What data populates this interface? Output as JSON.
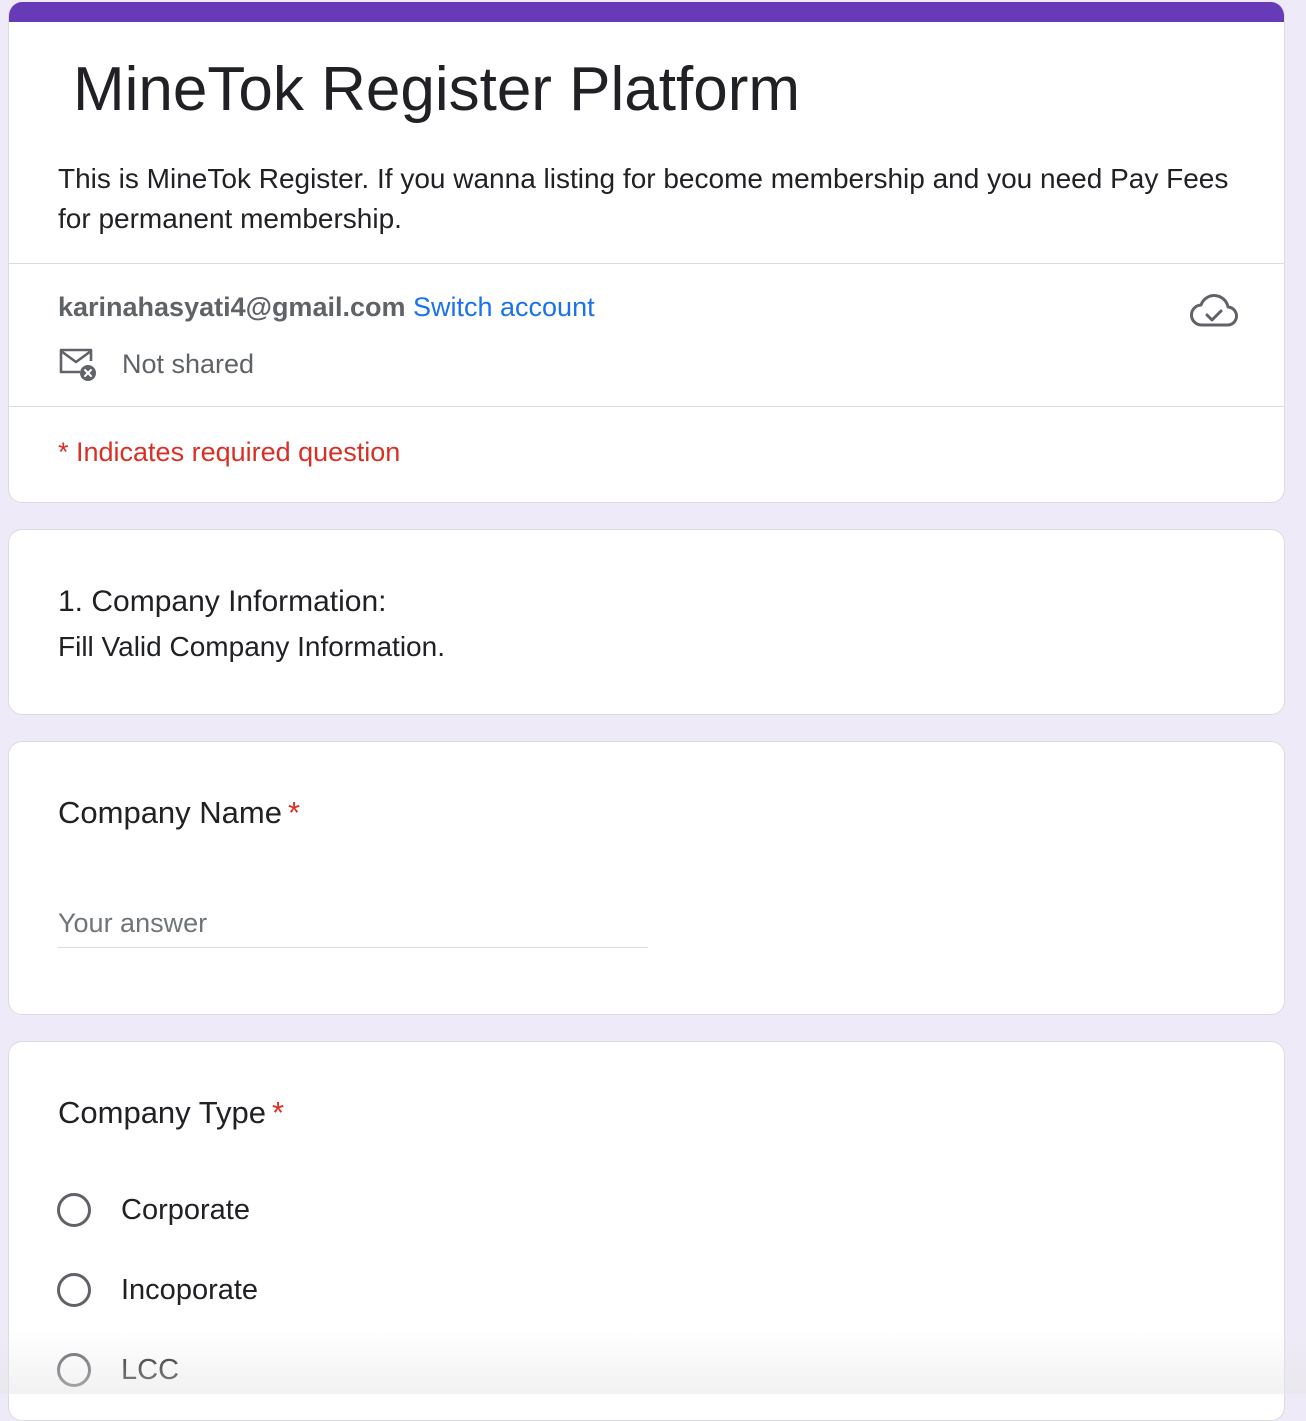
{
  "form": {
    "title": "MineTok Register Platform",
    "description": "This is MineTok Register. If you wanna listing for become membership and you need Pay Fees for permanent membership.",
    "accent_color": "#673ab7"
  },
  "account": {
    "email": "karinahasyati4@gmail.com",
    "switch_label": "Switch account",
    "status_icon": "cloud-check-icon",
    "not_shared_icon": "mail-off-icon",
    "not_shared_label": "Not shared"
  },
  "required_note": "* Indicates required question",
  "section": {
    "title": "1. Company Information:",
    "description": "Fill Valid Company Information."
  },
  "questions": [
    {
      "title": "Company Name",
      "required_mark": "*",
      "placeholder": "Your answer",
      "value": ""
    },
    {
      "title": "Company Type",
      "required_mark": "*",
      "options": [
        "Corporate",
        "Incoporate",
        "LCC"
      ]
    }
  ],
  "colors": {
    "background": "#efeaf7",
    "required": "#d93025",
    "link": "#1a73e8"
  }
}
